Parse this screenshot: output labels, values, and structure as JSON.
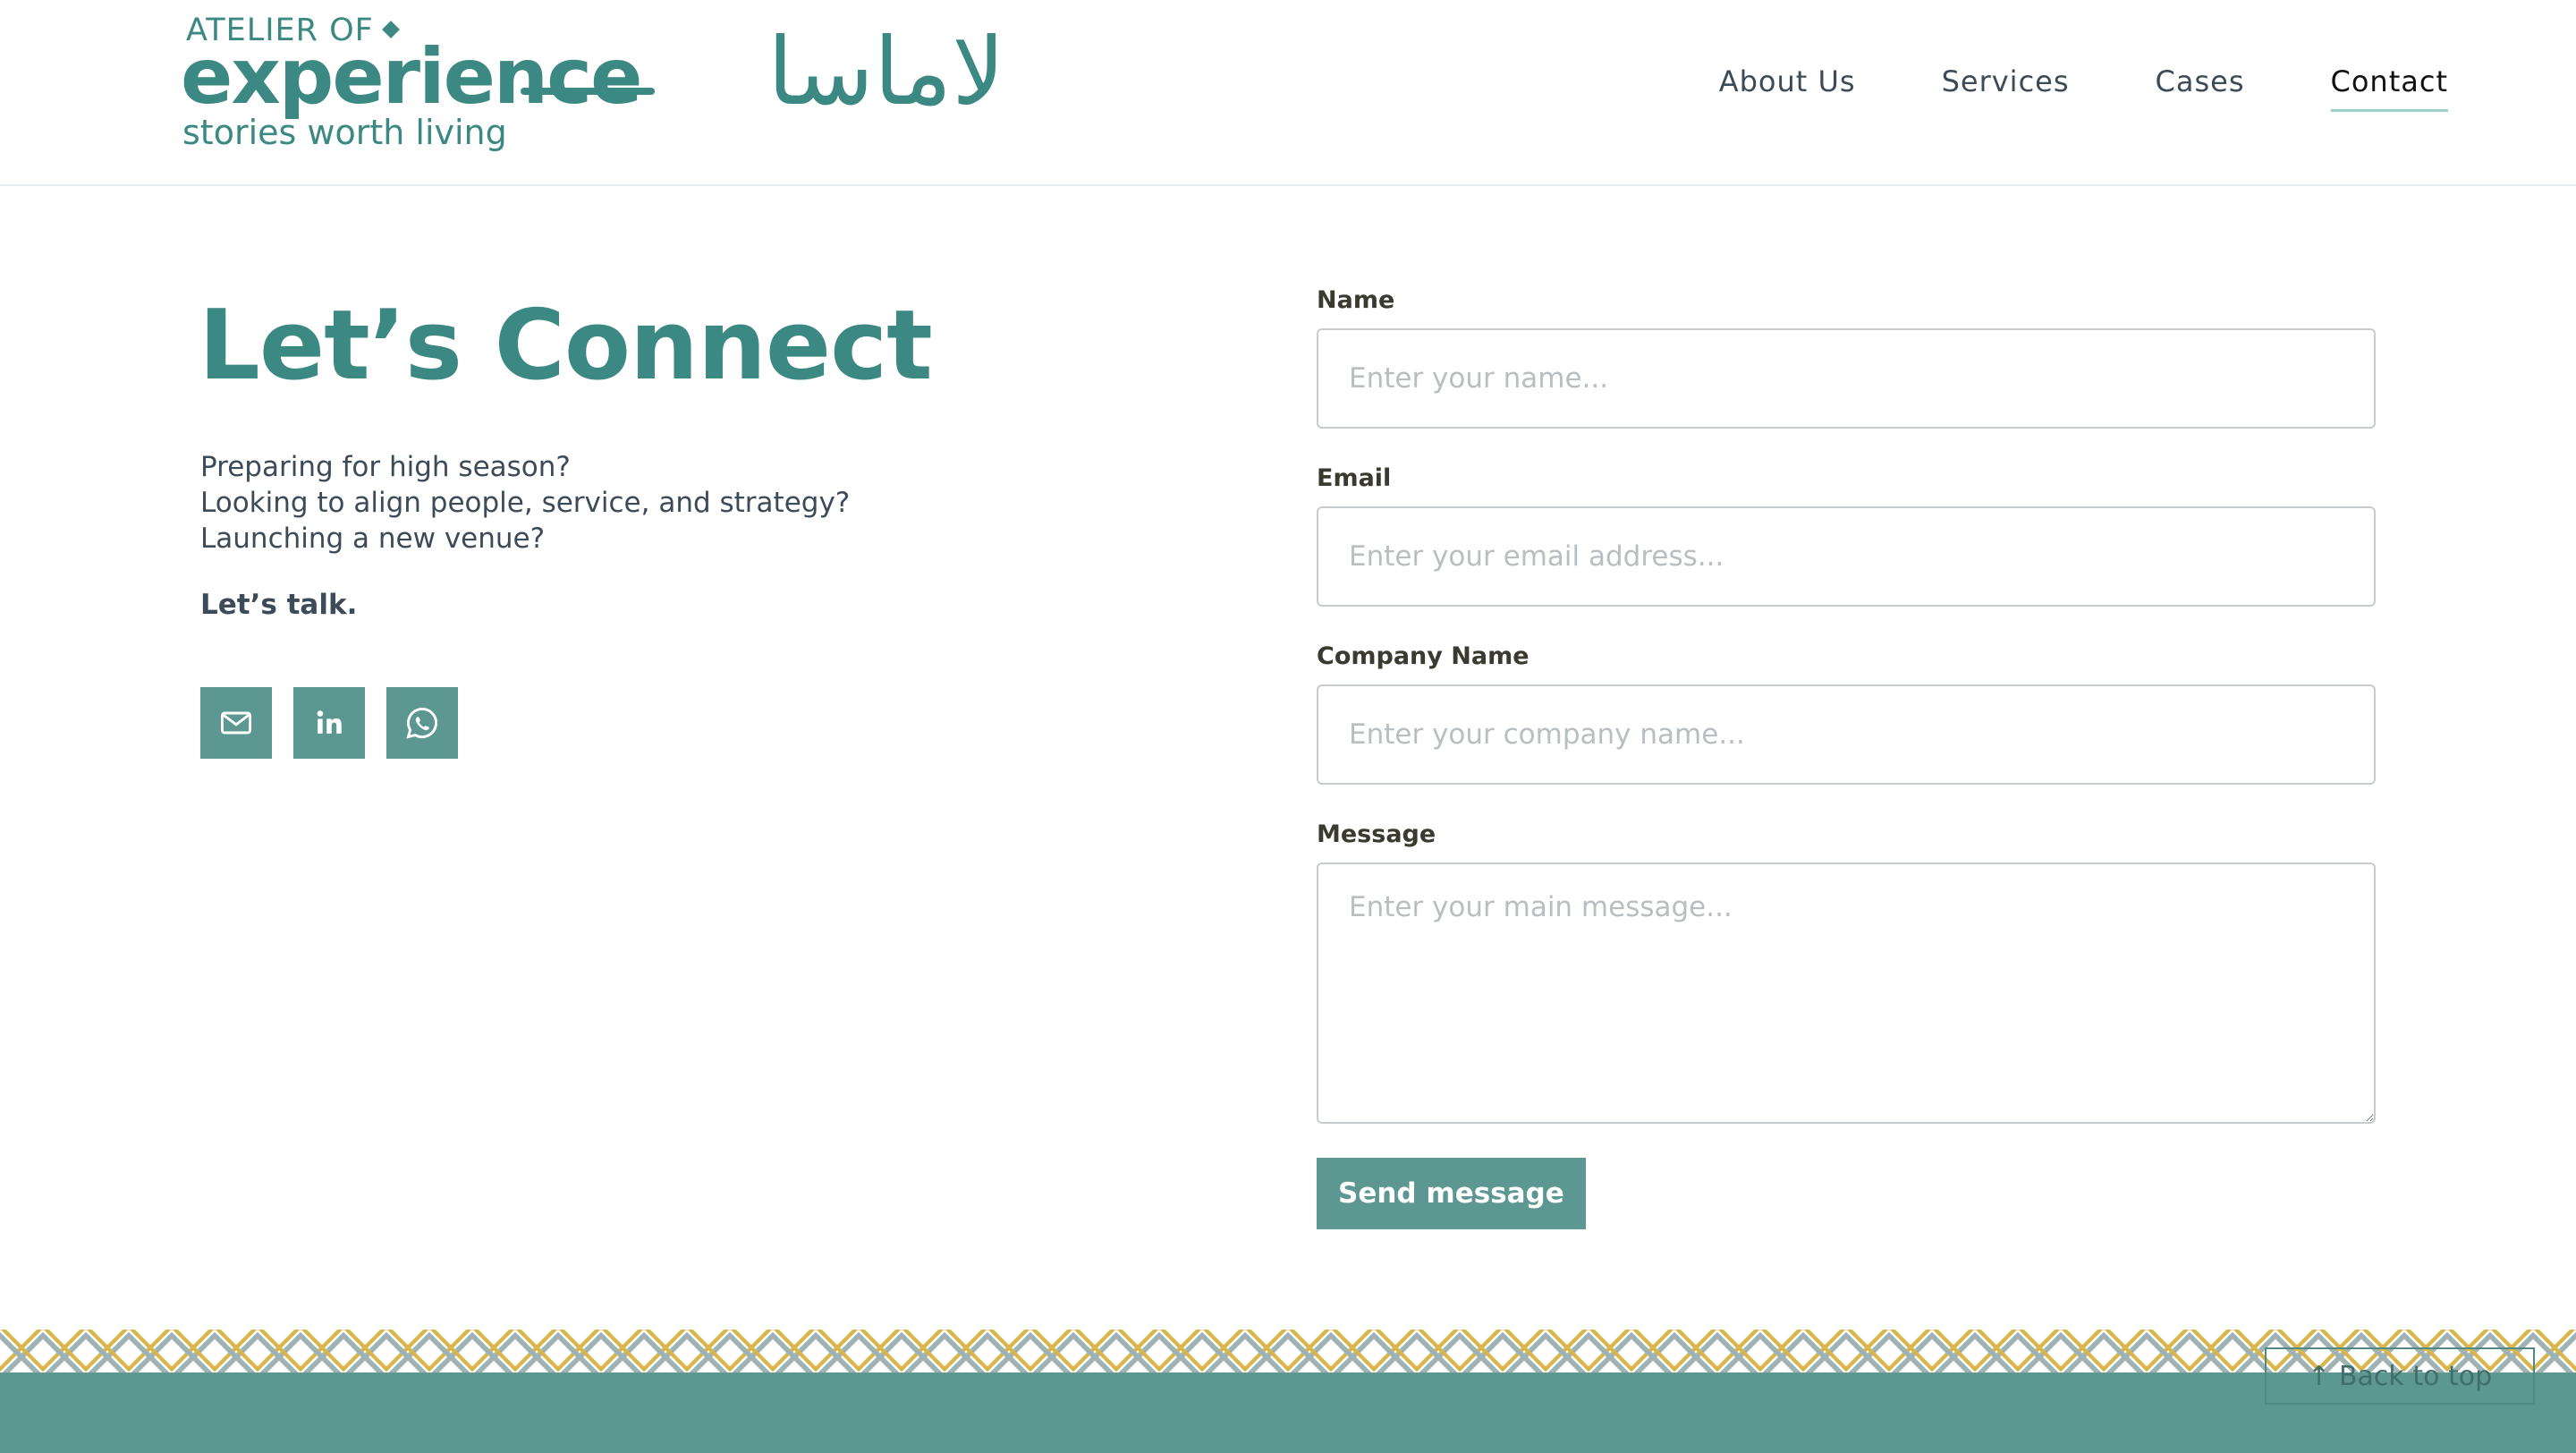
{
  "brand": {
    "atelier": "ATELIER OF",
    "wordmark": "experience",
    "tagline": "stories worth living",
    "arabic": "لاماسا",
    "color": "#3b8982"
  },
  "nav": {
    "items": [
      {
        "label": "About Us"
      },
      {
        "label": "Services"
      },
      {
        "label": "Cases"
      },
      {
        "label": "Contact",
        "active": true
      }
    ]
  },
  "contact": {
    "heading": "Let’s Connect",
    "intro_lines": [
      "Preparing for high season?",
      "Looking to align people, service, and strategy?",
      "Launching a new venue?"
    ],
    "talk": "Let’s talk.",
    "socials": [
      {
        "icon": "mail-icon",
        "label": "Email"
      },
      {
        "icon": "linkedin-icon",
        "label": "LinkedIn"
      },
      {
        "icon": "whatsapp-icon",
        "label": "WhatsApp"
      }
    ]
  },
  "form": {
    "name_label": "Name",
    "name_placeholder": "Enter your name...",
    "email_label": "Email",
    "email_placeholder": "Enter your email address...",
    "company_label": "Company Name",
    "company_placeholder": "Enter your company name...",
    "message_label": "Message",
    "message_placeholder": "Enter your main message...",
    "submit_label": "Send message"
  },
  "footer": {
    "back_to_top": "Back to top",
    "accent": "#5c9792"
  }
}
